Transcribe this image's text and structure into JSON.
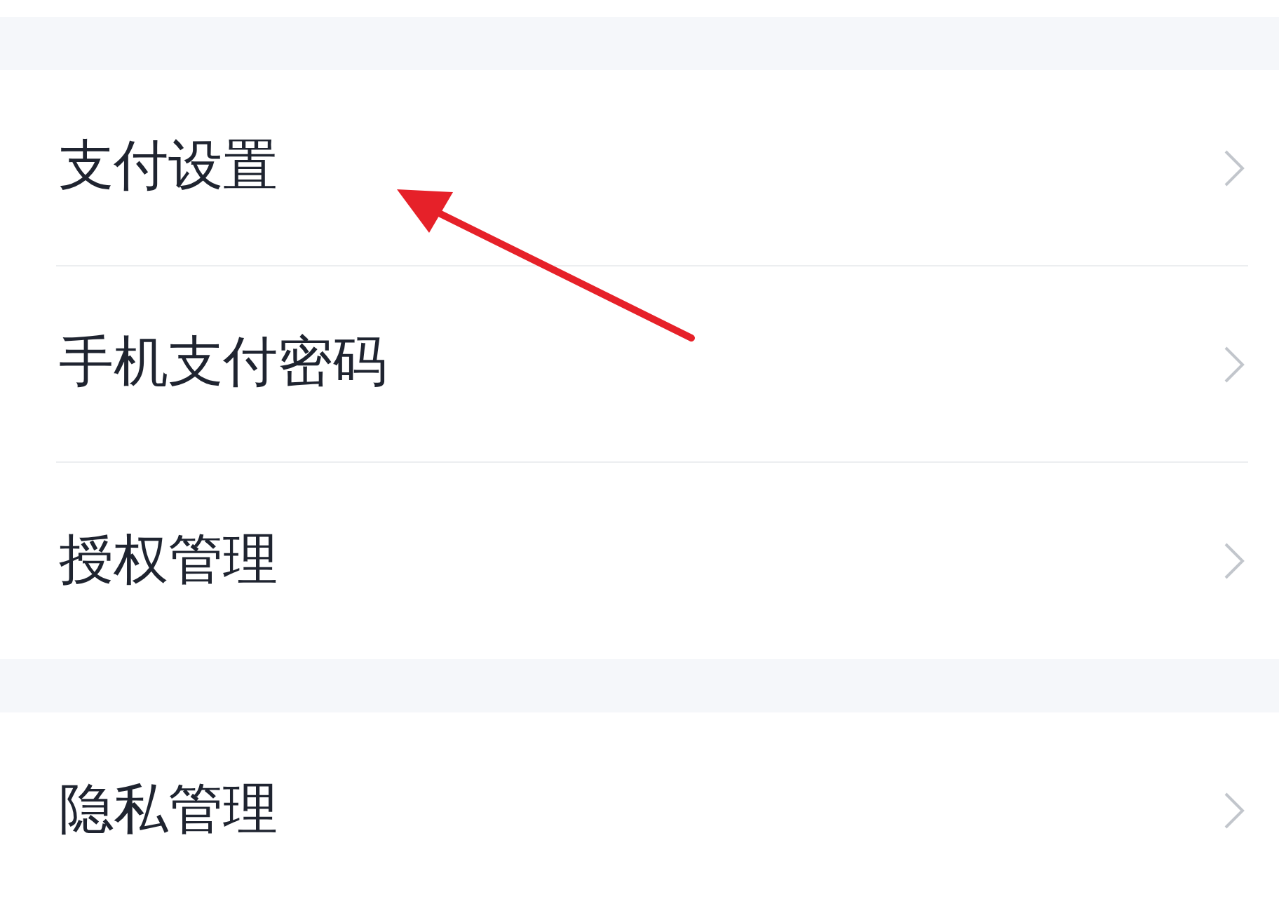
{
  "sections": [
    {
      "items": [
        {
          "label": "支付设置",
          "marked": true
        },
        {
          "label": "手机支付密码",
          "marked": false
        },
        {
          "label": "授权管理",
          "marked": false
        }
      ]
    },
    {
      "items": [
        {
          "label": "隐私管理",
          "marked": false
        }
      ]
    }
  ]
}
